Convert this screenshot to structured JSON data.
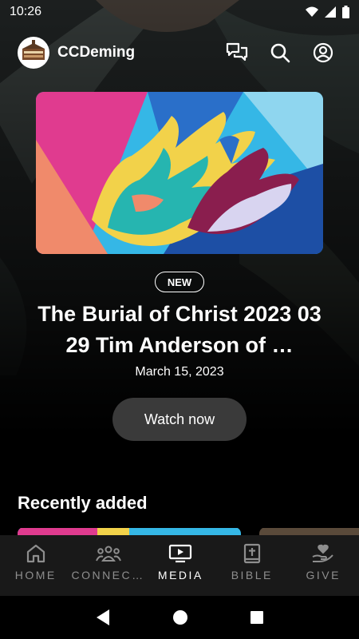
{
  "status_bar": {
    "time": "10:26"
  },
  "header": {
    "app_name": "CCDeming"
  },
  "hero": {
    "badge": "NEW",
    "title": "The Burial of Christ 2023 03 29 Tim Anderson of …",
    "date": "March 15, 2023",
    "watch_label": "Watch now"
  },
  "recently_added": {
    "title": "Recently added"
  },
  "tabs": [
    {
      "label": "HOME",
      "icon": "home-icon"
    },
    {
      "label": "CONNEC…",
      "icon": "group-icon"
    },
    {
      "label": "MEDIA",
      "icon": "tv-play-icon",
      "active": true
    },
    {
      "label": "BIBLE",
      "icon": "bible-icon"
    },
    {
      "label": "GIVE",
      "icon": "heart-hand-icon"
    }
  ],
  "colors": {
    "accent": "#ffffff",
    "tab_inactive": "#8e8e8e",
    "tab_bar": "#191919",
    "watch_button": "#3a3a3a"
  }
}
